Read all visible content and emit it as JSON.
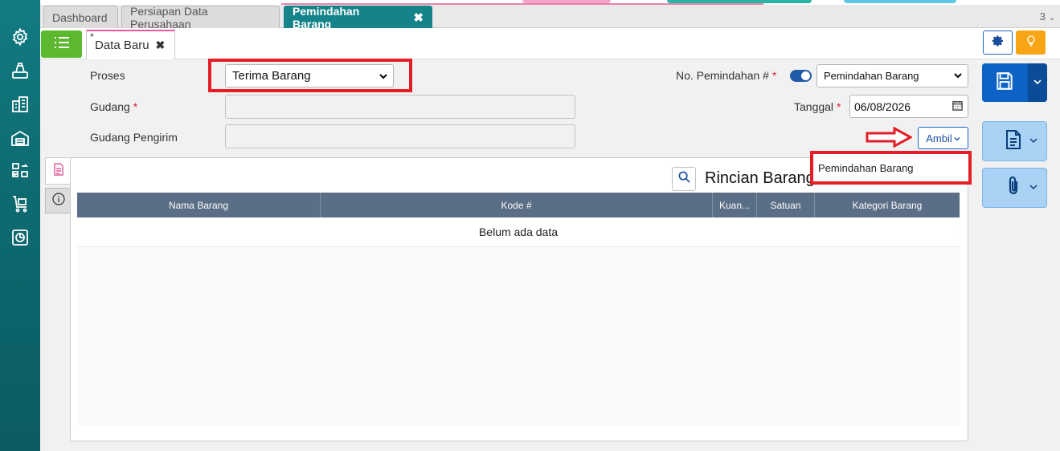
{
  "tabs": {
    "items": [
      {
        "label": "Dashboard"
      },
      {
        "label": "Persiapan Data Perusahaan"
      },
      {
        "label": "Pemindahan Barang"
      }
    ],
    "count": "3"
  },
  "subtab": {
    "modified_marker": "*",
    "label": "Data Baru"
  },
  "form": {
    "proses_label": "Proses",
    "proses_value": "Terima Barang",
    "gudang_label": "Gudang",
    "gudang_pengirim_label": "Gudang Pengirim",
    "no_label": "No. Pemindahan #",
    "no_value": "Pemindahan Barang",
    "tanggal_label": "Tanggal",
    "tanggal_value": "06/08/2026",
    "required_mark": "*"
  },
  "ambil": {
    "label": "Ambil",
    "menu_item": "Pemindahan Barang"
  },
  "panel": {
    "title": "Rincian Barang",
    "columns": [
      "Nama Barang",
      "Kode #",
      "Kuan...",
      "Satuan",
      "Kategori Barang"
    ],
    "empty_text": "Belum ada data"
  },
  "colors": {
    "sidebar": "#127b82",
    "active_tab": "#14838a",
    "menu_green": "#5cb82e",
    "save_blue": "#0c63c5",
    "bulb_orange": "#f8a515",
    "grid_header": "#5a6e85",
    "highlight_red": "#e41e26"
  },
  "icons": [
    "gear-icon",
    "scale-icon",
    "building-icon",
    "warehouse-icon",
    "transfer-icon",
    "cart-icon",
    "chart-icon",
    "list-icon",
    "settings-icon",
    "bulb-icon",
    "save-icon",
    "document-icon",
    "paperclip-icon",
    "search-icon",
    "info-icon",
    "calendar-icon",
    "arrow-right-icon"
  ]
}
